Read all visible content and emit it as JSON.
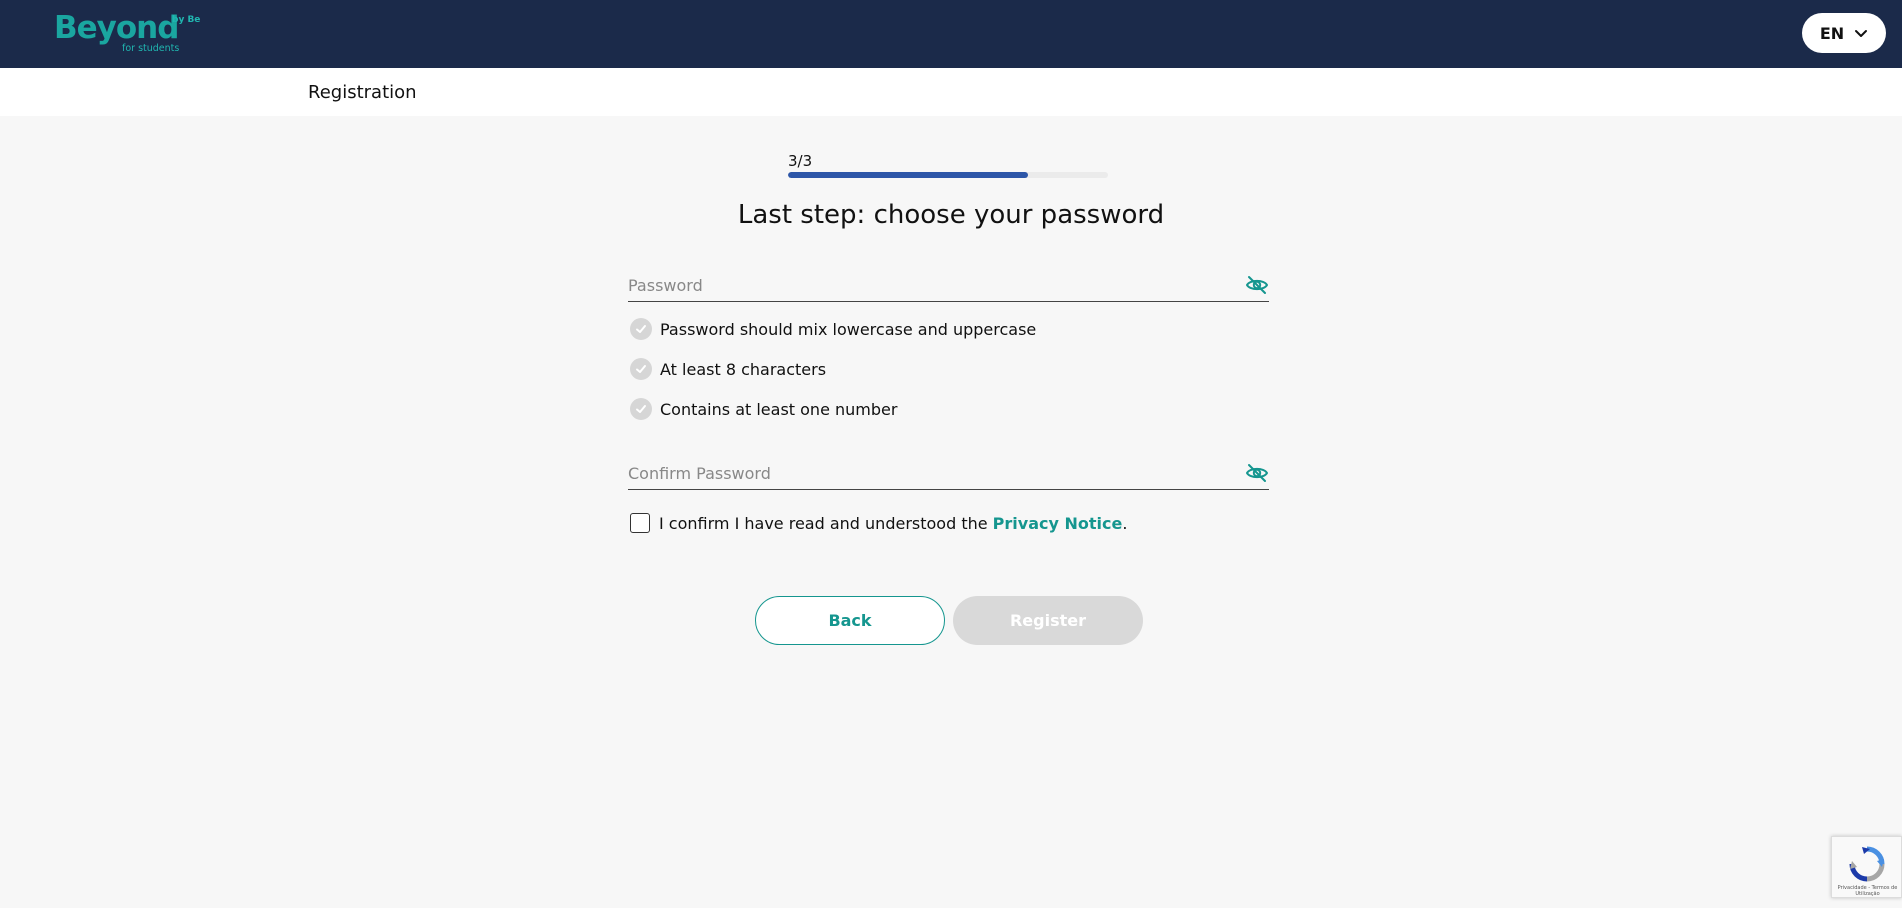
{
  "header": {
    "logo": {
      "main": "Beyond",
      "by": "by Be",
      "sub": "for students"
    },
    "language": {
      "label": "EN",
      "icon": "chevron-down-icon"
    },
    "colors": {
      "navbar": "#1b2a4a",
      "accent": "#15968f"
    }
  },
  "subheader": {
    "title": "Registration"
  },
  "progress": {
    "label": "3/3",
    "fraction": 0.75
  },
  "form": {
    "heading": "Last step: choose your password",
    "password": {
      "placeholder": "Password",
      "value": "",
      "toggle_icon": "eye-off-icon"
    },
    "rules": [
      {
        "label": "Password should mix lowercase and uppercase",
        "met": false
      },
      {
        "label": "At least 8 characters",
        "met": false
      },
      {
        "label": "Contains at least one number",
        "met": false
      }
    ],
    "confirm_password": {
      "placeholder": "Confirm Password",
      "value": "",
      "toggle_icon": "eye-off-icon"
    },
    "consent": {
      "text": "I confirm I have read and understood the",
      "link": "Privacy Notice",
      "suffix": ".",
      "checked": false
    },
    "buttons": {
      "back": "Back",
      "register": "Register"
    }
  },
  "recaptcha": {
    "text": "Privacidade - Termos de Utilização"
  }
}
